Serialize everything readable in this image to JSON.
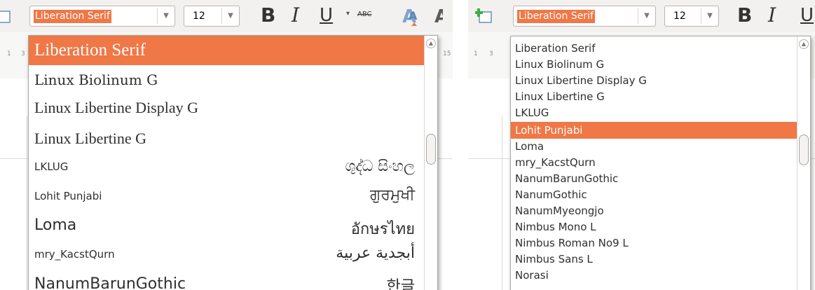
{
  "left": {
    "font_name": "Liberation Serif",
    "font_size": "12",
    "bold": "B",
    "italic": "I",
    "underline": "U",
    "strike": "ABC",
    "ruler_marks": [
      "1",
      "3",
      "15"
    ],
    "fonts": [
      {
        "name": "Liberation Serif",
        "preview": "",
        "selected": true
      },
      {
        "name": "Linux Biolinum G",
        "preview": ""
      },
      {
        "name": "Linux Libertine Display G",
        "preview": ""
      },
      {
        "name": "Linux Libertine G",
        "preview": ""
      },
      {
        "name": "LKLUG",
        "preview": "ශුද්ධ සිංහල"
      },
      {
        "name": "Lohit Punjabi",
        "preview": "ਗੁਰਮੁਖੀ"
      },
      {
        "name": "Loma",
        "preview": "อักษรไทย"
      },
      {
        "name": "mry_KacstQurn",
        "preview": "أبجدية عربية"
      },
      {
        "name": "NanumBarunGothic",
        "preview": "한글"
      }
    ]
  },
  "right": {
    "font_name": "Liberation Serif",
    "font_size": "12",
    "bold": "B",
    "italic": "I",
    "underline": "U",
    "ruler_marks": [
      "1",
      "3"
    ],
    "fonts": [
      {
        "name": "Liberation Serif"
      },
      {
        "name": "Linux Biolinum G"
      },
      {
        "name": "Linux Libertine Display G"
      },
      {
        "name": "Linux Libertine G"
      },
      {
        "name": "LKLUG"
      },
      {
        "name": "Lohit Punjabi",
        "selected": true
      },
      {
        "name": "Loma"
      },
      {
        "name": "mry_KacstQurn"
      },
      {
        "name": "NanumBarunGothic"
      },
      {
        "name": "NanumGothic"
      },
      {
        "name": "NanumMyeongjo"
      },
      {
        "name": "Nimbus Mono L"
      },
      {
        "name": "Nimbus Roman No9 L"
      },
      {
        "name": "Nimbus Sans L"
      },
      {
        "name": "Norasi"
      }
    ]
  },
  "colors": {
    "accent": "#f07746"
  },
  "icons": [
    "frame-icon",
    "add-frame-icon",
    "scroll-up-arrow-icon",
    "font-color-icon"
  ]
}
